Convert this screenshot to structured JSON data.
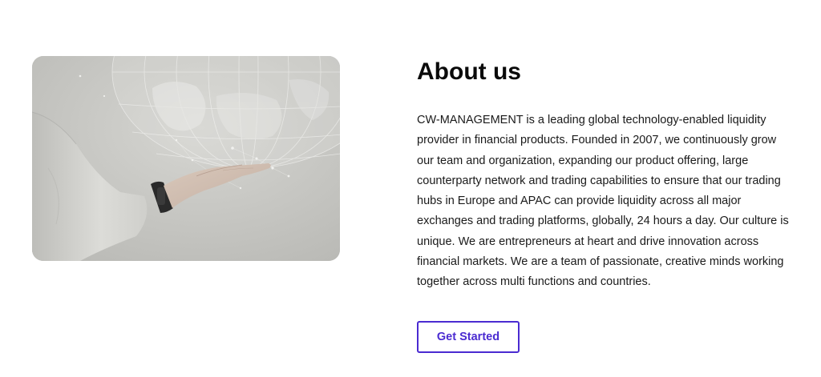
{
  "about": {
    "title": "About us",
    "paragraph": "CW-MANAGEMENT is a leading global technology-enabled liquidity provider in financial products. Founded in 2007, we continuously grow our team and organization, expanding our product offering, large counterparty network and trading capabilities to ensure that our trading hubs in Europe and APAC can provide liquidity across all major exchanges and trading platforms, globally, 24 hours a day. Our culture is unique. We are entrepreneurs at heart and drive innovation across financial markets. We are a team of passionate, creative minds working together across multi functions and countries.",
    "cta_label": "Get Started"
  },
  "image": {
    "icon": "hand-holding-globe-photo"
  },
  "colors": {
    "accent": "#4a2bd1",
    "text": "#1a1a1a",
    "image_bg": "#c6c6c2"
  }
}
